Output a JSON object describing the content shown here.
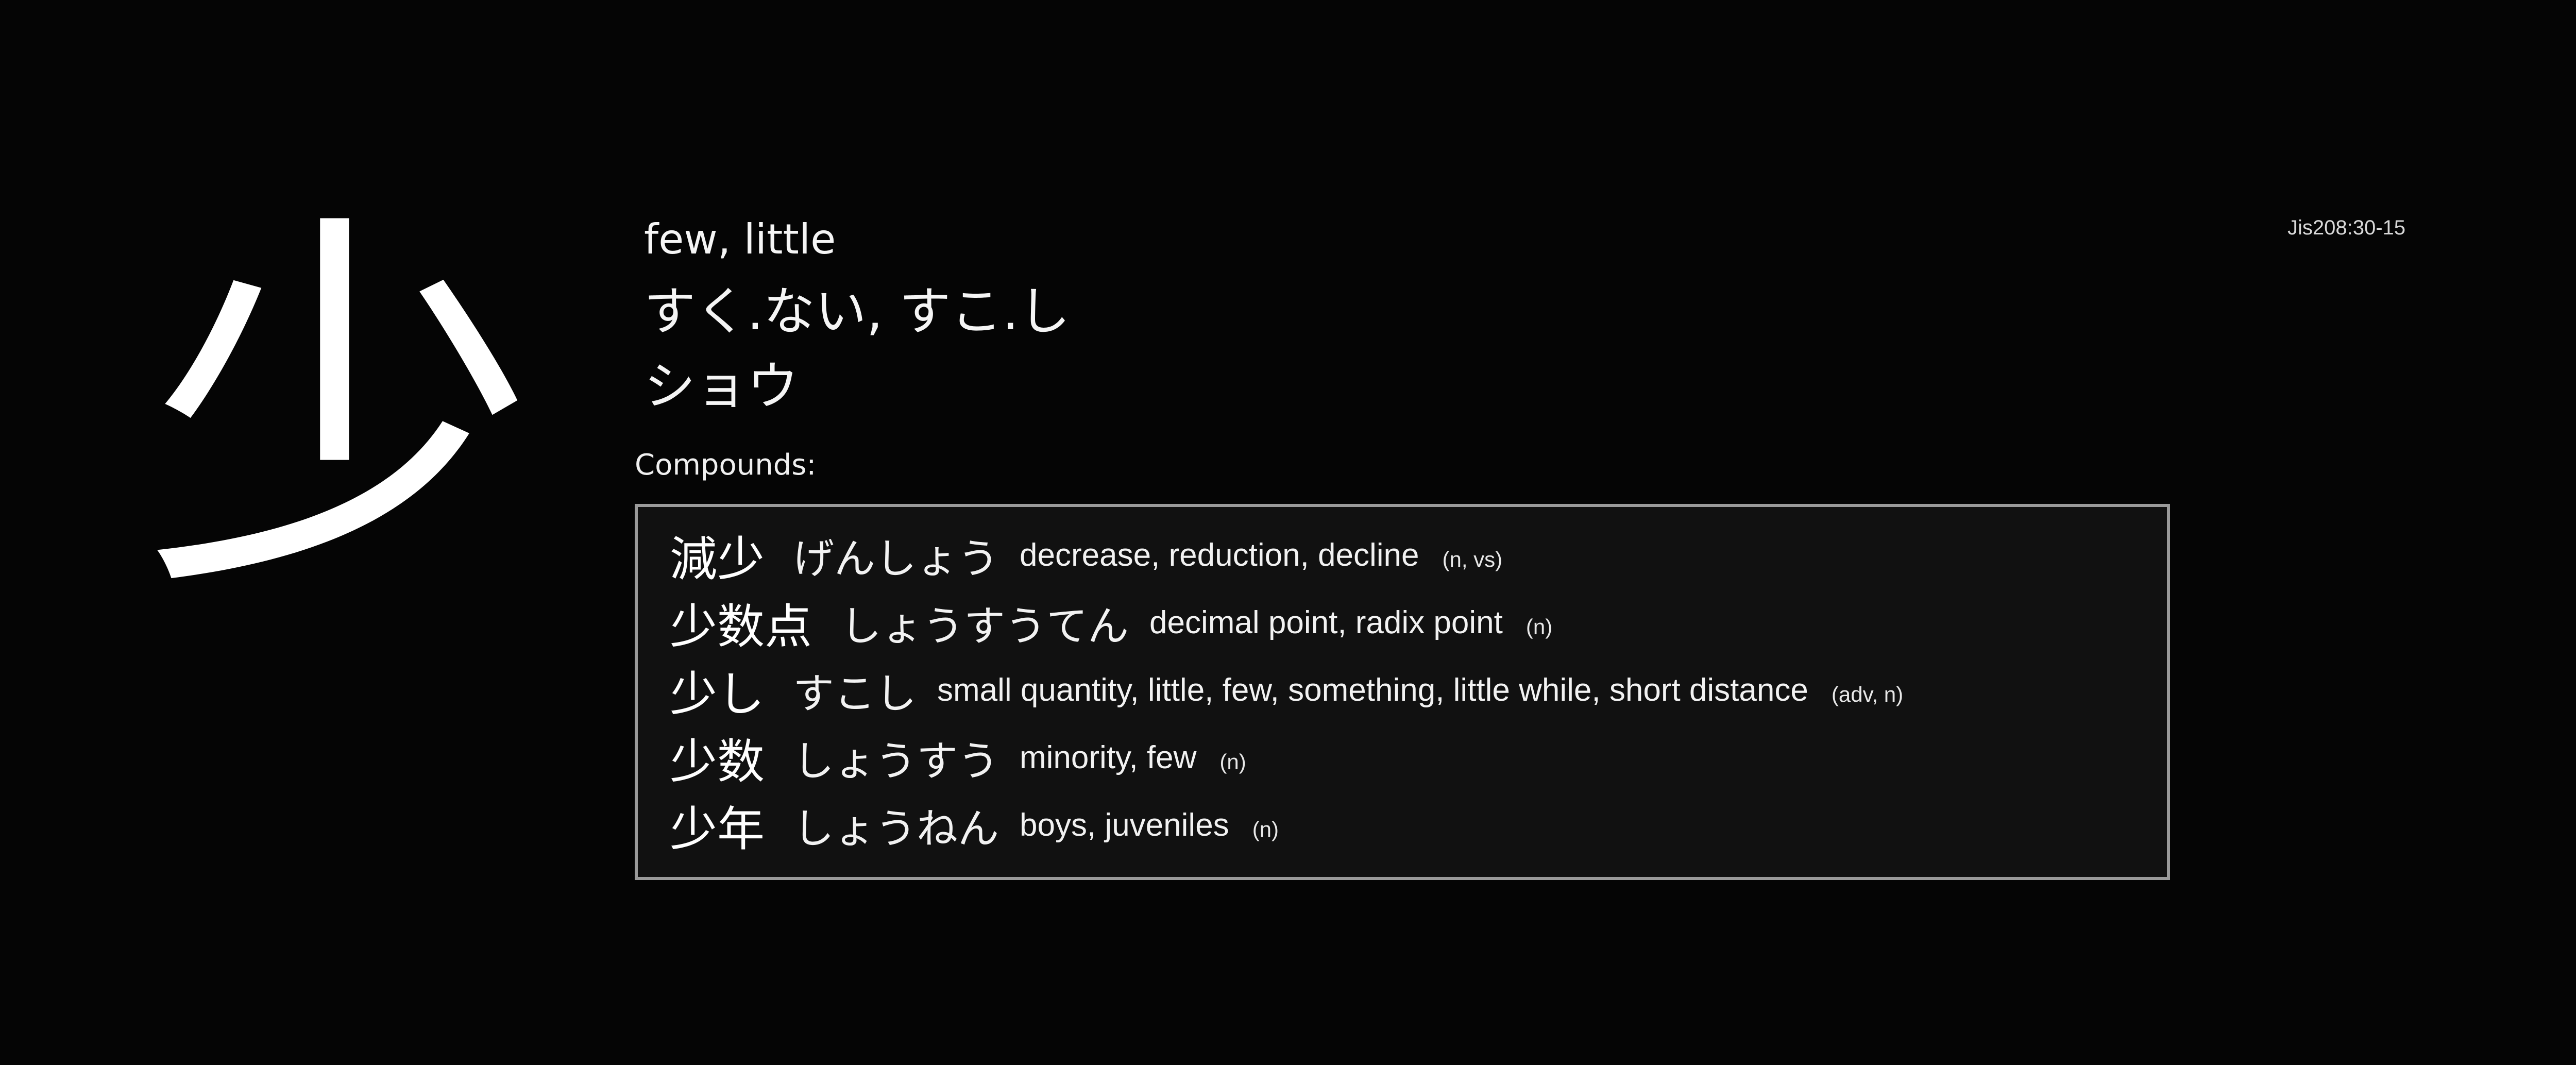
{
  "kanji": "少",
  "meaning": "few, little",
  "kun_readings": "すく.ない, すこ.し",
  "on_readings": "ショウ",
  "jis_code": "Jis208:30-15",
  "compounds_label": "Compounds:",
  "compounds": [
    {
      "word": "減少",
      "reading": "げんしょう",
      "definition": "decrease, reduction, decline",
      "pos": "(n, vs)"
    },
    {
      "word": "少数点",
      "reading": "しょうすうてん",
      "definition": "decimal point, radix point",
      "pos": "(n)"
    },
    {
      "word": "少し",
      "reading": "すこし",
      "definition": "small quantity, little, few, something, little while, short distance",
      "pos": "(adv, n)"
    },
    {
      "word": "少数",
      "reading": "しょうすう",
      "definition": "minority, few",
      "pos": "(n)"
    },
    {
      "word": "少年",
      "reading": "しょうねん",
      "definition": "boys, juveniles",
      "pos": "(n)"
    }
  ]
}
